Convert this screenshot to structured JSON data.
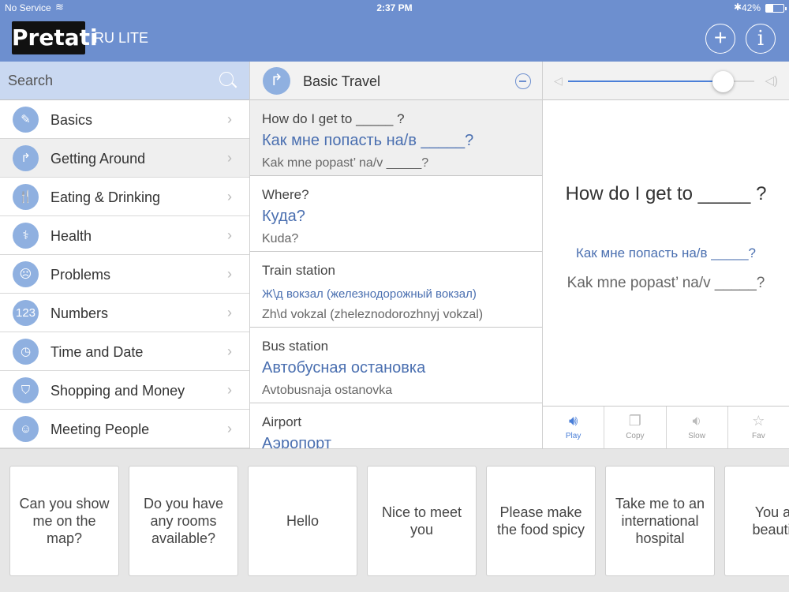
{
  "status": {
    "carrier": "No Service",
    "time": "2:37 PM",
    "battery_percent": "42%",
    "battery_level": 0.42
  },
  "header": {
    "logo": "Pretati",
    "subtitle": "RU LITE"
  },
  "search": {
    "placeholder": "Search"
  },
  "categories": [
    {
      "label": "Basics",
      "icon": "✎"
    },
    {
      "label": "Getting Around",
      "icon": "↱"
    },
    {
      "label": "Eating & Drinking",
      "icon": "🍴"
    },
    {
      "label": "Health",
      "icon": "⚕"
    },
    {
      "label": "Problems",
      "icon": "☹"
    },
    {
      "label": "Numbers",
      "icon": "123"
    },
    {
      "label": "Time and Date",
      "icon": "◷"
    },
    {
      "label": "Shopping and Money",
      "icon": "⛉"
    },
    {
      "label": "Meeting People",
      "icon": "☺"
    }
  ],
  "phrase_list": {
    "title": "Basic Travel",
    "items": [
      {
        "en": "How do I get to _____ ?",
        "ru": "Как мне попасть на/в _____?",
        "tr": "Kak mne popast’ na/v _____?"
      },
      {
        "en": "Where?",
        "ru": "Куда?",
        "tr": "Kuda?"
      },
      {
        "en": "Train station",
        "ru": "Ж\\д вокзал (железнодорожный вокзал)",
        "tr": "Zh\\d vokzal (zheleznodorozhnyj vokzal)"
      },
      {
        "en": "Bus station",
        "ru": "Автобусная остановка",
        "tr": "Avtobusnaja ostanovka"
      },
      {
        "en": "Airport",
        "ru": "Аэропорт",
        "tr": ""
      }
    ]
  },
  "volume": {
    "level": 0.83
  },
  "detail": {
    "en": "How do I get to _____ ?",
    "ru": "Как мне попасть на/в _____?",
    "tr": "Kak mne popast’ na/v _____?"
  },
  "actions": {
    "play": "Play",
    "copy": "Copy",
    "slow": "Slow",
    "fav": "Fav"
  },
  "quick_phrases": [
    "Can you show me on the map?",
    "Do you have any rooms available?",
    "Hello",
    "Nice to meet you",
    "Please make the food spicy",
    "Take me to an international hospital",
    "You are beautiful"
  ]
}
